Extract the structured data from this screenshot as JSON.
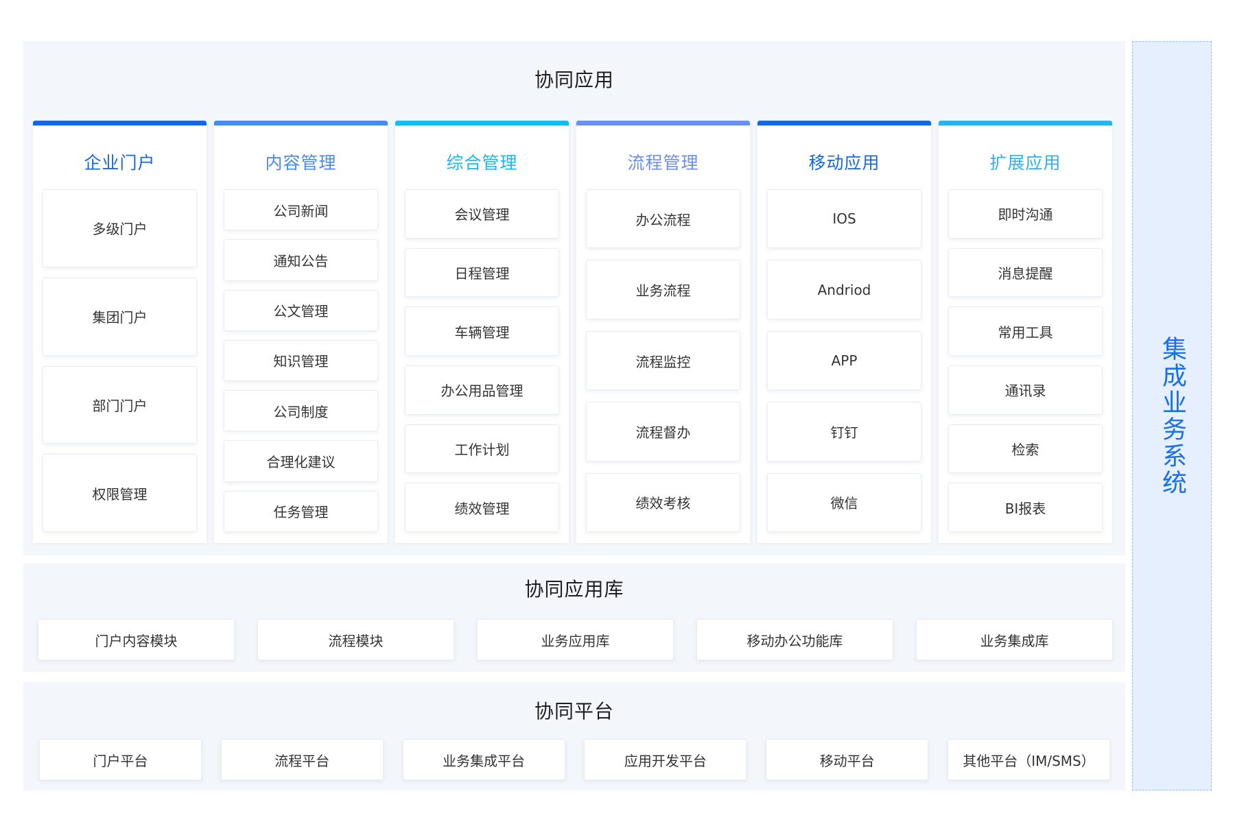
{
  "main_section": {
    "title": "协同应用",
    "columns": [
      {
        "title": "企业门户",
        "color": "#1667e6",
        "items": [
          "多级门户",
          "集团门户",
          "部门门户",
          "权限管理"
        ]
      },
      {
        "title": "内容管理",
        "color": "#4a8af0",
        "items": [
          "公司新闻",
          "通知公告",
          "公文管理",
          "知识管理",
          "公司制度",
          "合理化建议",
          "任务管理"
        ]
      },
      {
        "title": "综合管理",
        "color": "#14bbee",
        "items": [
          "会议管理",
          "日程管理",
          "车辆管理",
          "办公用品管理",
          "工作计划",
          "绩效管理"
        ]
      },
      {
        "title": "流程管理",
        "color": "#6b8ef0",
        "items": [
          "办公流程",
          "业务流程",
          "流程监控",
          "流程督办",
          "绩效考核"
        ]
      },
      {
        "title": "移动应用",
        "color": "#1667e6",
        "items": [
          "IOS",
          "Andriod",
          "APP",
          "钉钉",
          "微信"
        ]
      },
      {
        "title": "扩展应用",
        "color": "#2ab2ee",
        "items": [
          "即时沟通",
          "消息提醒",
          "常用工具",
          "通讯录",
          "检索",
          "BI报表"
        ]
      }
    ]
  },
  "library_section": {
    "title": "协同应用库",
    "items": [
      "门户内容模块",
      "流程模块",
      "业务应用库",
      "移动办公功能库",
      "业务集成库"
    ]
  },
  "platform_section": {
    "title": "协同平台",
    "items": [
      "门户平台",
      "流程平台",
      "业务集成平台",
      "应用开发平台",
      "移动平台",
      "其他平台（IM/SMS）"
    ]
  },
  "side_panel": {
    "label": "集成业务系统",
    "color": "#1a6ee8"
  }
}
